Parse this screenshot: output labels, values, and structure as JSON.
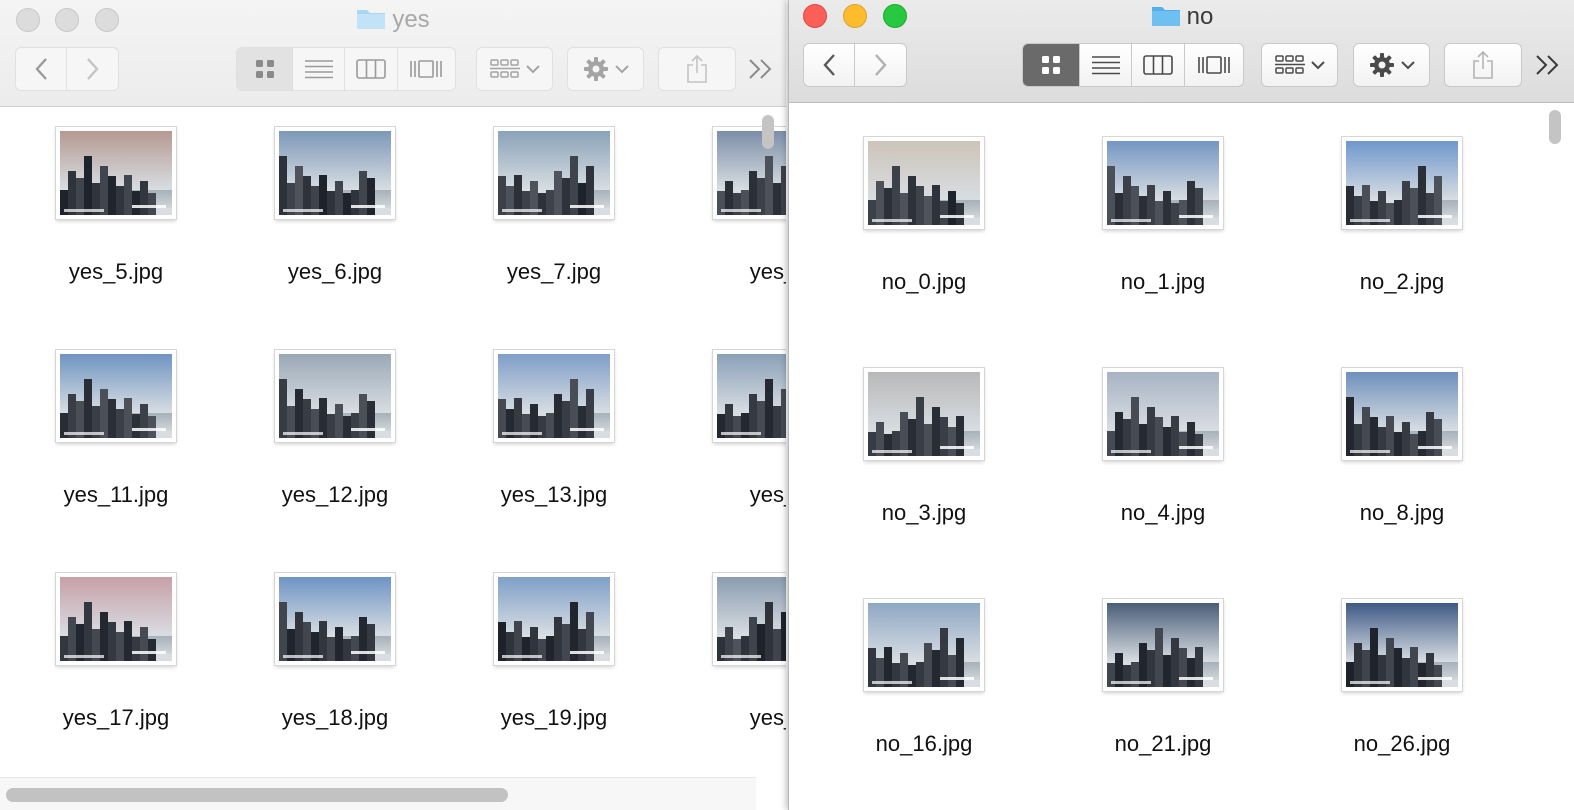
{
  "windows": {
    "yes": {
      "title": "yes",
      "files": [
        {
          "name": "yes_5.jpg",
          "sky": "#b59a92"
        },
        {
          "name": "yes_6.jpg",
          "sky": "#7c98b8"
        },
        {
          "name": "yes_7.jpg",
          "sky": "#8aa2b8"
        },
        {
          "name": "yes_",
          "sky": "#7c8fa8"
        },
        {
          "name": "yes_11.jpg",
          "sky": "#6f94c2"
        },
        {
          "name": "yes_12.jpg",
          "sky": "#9aa8b6"
        },
        {
          "name": "yes_13.jpg",
          "sky": "#7f9ec8"
        },
        {
          "name": "yes_",
          "sky": "#8aa0b8"
        },
        {
          "name": "yes_17.jpg",
          "sky": "#c7a0a8"
        },
        {
          "name": "yes_18.jpg",
          "sky": "#6e94c4"
        },
        {
          "name": "yes_19.jpg",
          "sky": "#7fa0c8"
        },
        {
          "name": "yes_",
          "sky": "#8a9cb0"
        }
      ]
    },
    "no": {
      "title": "no",
      "files": [
        {
          "name": "no_0.jpg",
          "sky": "#cdc4b8"
        },
        {
          "name": "no_1.jpg",
          "sky": "#7496c2"
        },
        {
          "name": "no_2.jpg",
          "sky": "#6f97cc"
        },
        {
          "name": "no_3.jpg",
          "sky": "#b8b8b8"
        },
        {
          "name": "no_4.jpg",
          "sky": "#a8b4c4"
        },
        {
          "name": "no_8.jpg",
          "sky": "#6e90bc"
        },
        {
          "name": "no_16.jpg",
          "sky": "#8ea8c4"
        },
        {
          "name": "no_21.jpg",
          "sky": "#4a5e78"
        },
        {
          "name": "no_26.jpg",
          "sky": "#3f5a86"
        }
      ]
    }
  },
  "icons": {
    "back": "chevron-left-icon",
    "forward": "chevron-right-icon",
    "view_icons": "grid-icon",
    "view_list": "list-icon",
    "view_columns": "columns-icon",
    "view_coverflow": "coverflow-icon",
    "arrange": "arrange-icon",
    "action": "gear-icon",
    "share": "share-icon",
    "overflow": "double-chevron-right-icon"
  },
  "colors": {
    "close": "#fc5f57",
    "minimize": "#fdbc2e",
    "maximize": "#28c840",
    "folder": "#6ec0f2"
  }
}
